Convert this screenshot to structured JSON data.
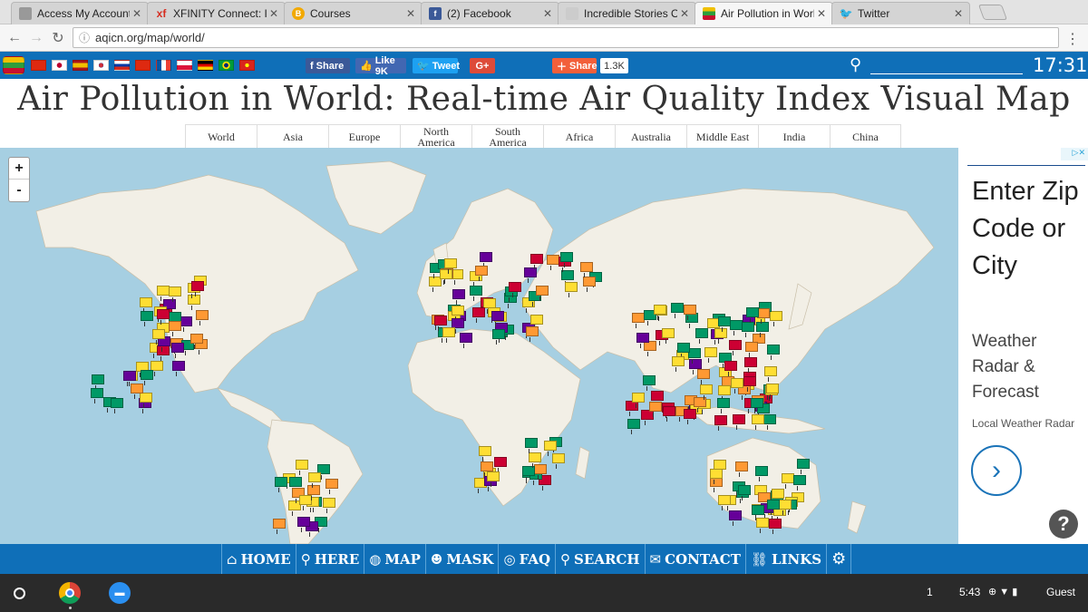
{
  "browser": {
    "tabs": [
      {
        "title": "Access My Account |",
        "favicon": "comcast-icon",
        "color": "#888888",
        "active": false
      },
      {
        "title": "XFINITY Connect: Int",
        "favicon": "xfinity-icon",
        "color": "#d62d20",
        "active": false
      },
      {
        "title": "Courses",
        "favicon": "courses-icon",
        "color": "#f2a900",
        "active": false
      },
      {
        "title": "(2) Facebook",
        "favicon": "facebook-icon",
        "color": "#3b5998",
        "active": false
      },
      {
        "title": "Incredible Stories Of",
        "favicon": "page-icon",
        "color": "#bbbbbb",
        "active": false
      },
      {
        "title": "Air Pollution in World",
        "favicon": "aqicn-icon",
        "color": "#e0a800",
        "active": true
      },
      {
        "title": "Twitter",
        "favicon": "twitter-icon",
        "color": "#1da1f2",
        "active": false
      }
    ],
    "url": "aqicn.org/map/world/"
  },
  "sitebar": {
    "flags": [
      "myanmar",
      "china",
      "japan",
      "spain",
      "korea",
      "russia",
      "hong-kong",
      "france",
      "poland",
      "germany",
      "brazil",
      "vietnam"
    ],
    "share_fb": "Share",
    "like": "Like 9K",
    "tweet": "Tweet",
    "gplus": "G+",
    "share2": "Share",
    "share_count": "1.3K",
    "time": "17:31"
  },
  "page": {
    "title": "Air Pollution in World: Real-time Air Quality Index Visual Map",
    "regions": [
      "World",
      "Asia",
      "Europe",
      "North America",
      "South America",
      "Africa",
      "Australia",
      "Middle East",
      "India",
      "China"
    ]
  },
  "map": {
    "zoom_in": "+",
    "zoom_out": "-",
    "colors": {
      "good": "#009966",
      "moderate": "#ffde33",
      "sensitive": "#ff9933",
      "unhealthy": "#cc0033",
      "very_unhealthy": "#660099",
      "hazardous": "#7e0023"
    }
  },
  "ad": {
    "headline": "Enter Zip Code or City",
    "sub": "Weather Radar & Forecast",
    "small": "Local Weather Radar",
    "arrow": "›",
    "corner": "▷✕",
    "help": "?"
  },
  "nav": [
    {
      "label": "HOME",
      "icon": "home-icon"
    },
    {
      "label": "HERE",
      "icon": "location-pin-icon"
    },
    {
      "label": "MAP",
      "icon": "globe-icon"
    },
    {
      "label": "MASK",
      "icon": "mask-icon"
    },
    {
      "label": "FAQ",
      "icon": "faq-icon"
    },
    {
      "label": "SEARCH",
      "icon": "search-icon"
    },
    {
      "label": "CONTACT",
      "icon": "contact-icon"
    },
    {
      "label": "LINKS",
      "icon": "link-icon"
    },
    {
      "label": "",
      "icon": "gear-icon"
    }
  ],
  "shelf": {
    "notifications": "1",
    "clock": "5:43",
    "user": "Guest"
  }
}
